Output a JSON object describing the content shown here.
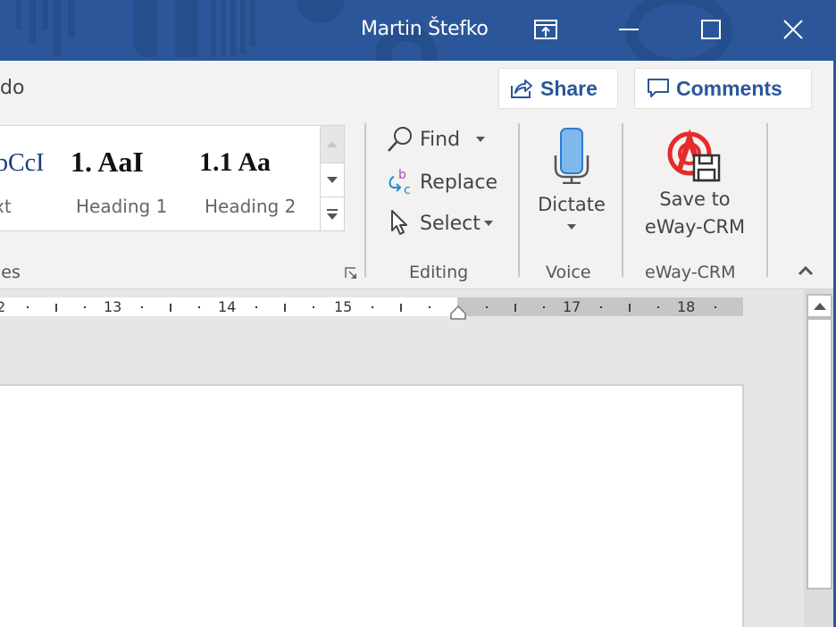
{
  "titlebar": {
    "user_name": "Martin Štefko",
    "controls": {
      "ribbon_display": "ribbon-display-options-icon",
      "minimize": "minimize-icon",
      "maximize": "maximize-icon",
      "close": "close-icon"
    },
    "color": "#2b579a"
  },
  "ribbon": {
    "tab_partial": "do",
    "share_label": "Share",
    "comments_label": "Comments",
    "styles_group": {
      "label_partial": "les",
      "items": [
        {
          "sample": "bCcI",
          "caption": "xt"
        },
        {
          "sample": "1.  AaI",
          "caption": "Heading 1"
        },
        {
          "sample": "1.1  Aa",
          "caption": "Heading 2"
        }
      ]
    },
    "editing_group": {
      "label": "Editing",
      "find": "Find",
      "replace": "Replace",
      "select": "Select"
    },
    "voice_group": {
      "label": "Voice",
      "dictate": "Dictate"
    },
    "eway_group": {
      "label": "eWay-CRM",
      "save_line1": "Save to",
      "save_line2": "eWay-CRM"
    }
  },
  "ruler": {
    "numbers": [
      "2",
      "13",
      "14",
      "15",
      "17",
      "18"
    ]
  },
  "accent_color": "#2b579a"
}
